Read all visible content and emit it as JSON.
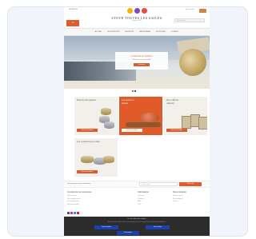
{
  "header": {
    "logo_text": "LE MOULIN",
    "brand_name": "STOVE TOUTES LES SAILES",
    "brand_sub": "Depuis 1880",
    "lang_label": "FR",
    "search_placeholder": "Rechercher...",
    "top_links": [
      "Mon compte",
      "Contact"
    ],
    "flag_colors": [
      "#f4b400",
      "#8e44ad",
      "#e74c3c"
    ]
  },
  "nav": {
    "items": [
      "Accueil",
      "Nos produits",
      "Recettes",
      "Savoir-faire",
      "Boutiques",
      "Contact"
    ]
  },
  "hero": {
    "title": "Conserves de tradition",
    "text": "Découvrez nos spécialités",
    "button": "Découvrir"
  },
  "tiles": [
    {
      "title": "Plats de nos régions",
      "button": "Voir les produits"
    },
    {
      "title": "Les épices et sauces",
      "button": "Voir les produits"
    },
    {
      "title": "Nos coffrets cadeaux",
      "button": "Voir les produits"
    },
    {
      "title": "Les conserves de la mer",
      "button": "Voir les produits"
    }
  ],
  "newsletter": {
    "text": "Inscrivez-vous à notre newsletter",
    "placeholder": "Votre e-mail",
    "button": "S'inscrire"
  },
  "footer": {
    "col1_head": "À propos de nos conserves",
    "col1_lines": [
      "Notre histoire",
      "Nos engagements",
      "Nos producteurs",
      "Mentions légales"
    ],
    "col2_head": "Informations",
    "col2_lines": [
      "Livraison",
      "Paiement",
      "FAQ",
      "CGV"
    ],
    "col3_head": "Nous contacter",
    "col3_lines": [
      "Service client",
      "Nos boutiques",
      "Presse"
    ],
    "social_colors": [
      "#3b5998",
      "#e1306c",
      "#1da1f2",
      "#c4302b"
    ]
  },
  "cookie": {
    "title": "Ce site utilise des cookies",
    "text": "Nous utilisons des cookies pour améliorer votre expérience et mesurer l'audience.",
    "accept": "Tout accepter",
    "refuse": "Tout refuser",
    "settings": "Paramétrer"
  },
  "colors": {
    "accent": "#e05a2a",
    "button_blue": "#1d3fb0"
  }
}
